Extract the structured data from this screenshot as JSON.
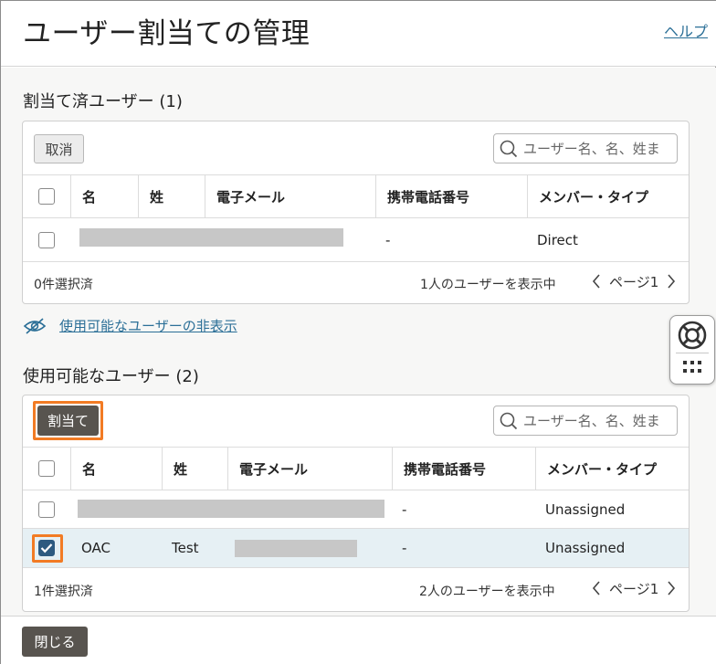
{
  "header": {
    "title": "ユーザー割当ての管理",
    "help_link": "ヘルプ"
  },
  "assigned": {
    "section_title": "割当て済ユーザー (1)",
    "remove_button": "取消",
    "search_placeholder": "ユーザー名、名、姓ま",
    "columns": [
      "名",
      "姓",
      "電子メール",
      "携帯電話番号",
      "メンバー・タイプ"
    ],
    "rows": [
      {
        "first_name": "",
        "last_name": "",
        "email": "",
        "phone": "-",
        "member_type": "Direct",
        "checked": false
      }
    ],
    "selected_count": "0件選択済",
    "showing": "1人のユーザーを表示中",
    "page_label": "ページ1"
  },
  "toggle_available": {
    "label": "使用可能なユーザーの非表示"
  },
  "available": {
    "section_title": "使用可能なユーザー (2)",
    "assign_button": "割当て",
    "search_placeholder": "ユーザー名、名、姓ま",
    "columns": [
      "名",
      "姓",
      "電子メール",
      "携帯電話番号",
      "メンバー・タイプ"
    ],
    "rows": [
      {
        "first_name": "",
        "last_name": "",
        "email": "",
        "phone": "-",
        "member_type": "Unassigned",
        "checked": false
      },
      {
        "first_name": "OAC",
        "last_name": "Test",
        "email": "",
        "phone": "-",
        "member_type": "Unassigned",
        "checked": true
      }
    ],
    "selected_count": "1件選択済",
    "showing": "2人のユーザーを表示中",
    "page_label": "ページ1"
  },
  "footer": {
    "close_button": "閉じる"
  },
  "colors": {
    "highlight": "#f27b24",
    "link": "#2b6f97",
    "dark_button": "#58544f",
    "checked": "#2d5a80",
    "selected_row": "#e6f0f4"
  },
  "icons": {
    "search": "search-icon",
    "eye_hidden": "eye-slash-icon",
    "help": "lifebuoy-icon",
    "grid": "grid-icon",
    "prev": "chevron-left-icon",
    "next": "chevron-right-icon",
    "check": "checkmark-icon"
  }
}
